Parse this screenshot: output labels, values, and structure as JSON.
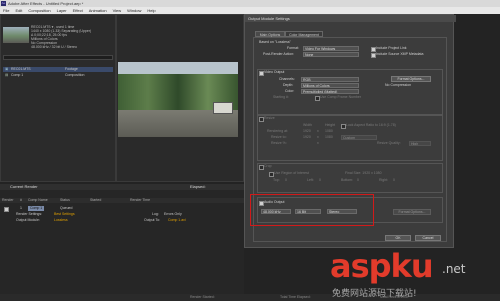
{
  "window": {
    "title": "Adobe After Effects - Untitled Project.aep *",
    "menu": [
      "File",
      "Edit",
      "Composition",
      "Layer",
      "Effect",
      "Animation",
      "View",
      "Window",
      "Help"
    ]
  },
  "project": {
    "info": [
      "REC01.MTS ▾ , used 1 time",
      "1440 x 1080 (1.33) Separating (Upper)",
      "Δ 0;00;22;18, 25.00 fps",
      "Millions of Colors",
      "No Compression",
      "48.000 kHz / 32 bit U / Stereo"
    ],
    "items": [
      {
        "name": "REC01.MTS",
        "type": "Footage"
      },
      {
        "name": "Comp 1",
        "type": "Composition"
      }
    ]
  },
  "timeline": {
    "header": "Current Render",
    "elapsed_label": "Elapsed:",
    "columns": [
      "Render",
      "#",
      "Comp Name",
      "Status",
      "Started",
      "Render Time"
    ],
    "row": {
      "num": "1",
      "comp": "Comp 1",
      "status": "Queued"
    },
    "render_settings_label": "Render Settings:",
    "render_settings_value": "Best Settings",
    "log_label": "Log:",
    "log_value": "Errors Only",
    "output_module_label": "Output Module:",
    "output_module_value": "Lossless",
    "output_to_label": "Output To:",
    "output_to_value": "Comp 1.avi"
  },
  "dialog": {
    "title": "Output Module Settings",
    "tabs": [
      "Main Options",
      "Color Management"
    ],
    "based_on_label": "Based on \"Lossless\"",
    "format_label": "Format:",
    "format_value": "Video For Windows",
    "post_render_label": "Post-Render Action:",
    "post_render_value": "None",
    "include_project_link": "Include Project Link",
    "include_xmp": "Include Source XMP Metadata",
    "video_output": "Video Output",
    "channels_label": "Channels:",
    "channels_value": "RGB",
    "format_options": "Format Options...",
    "depth_label": "Depth:",
    "depth_value": "Millions of Colors",
    "no_compression": "No Compression",
    "color_label": "Color:",
    "color_value": "Premultiplied (Matted)",
    "starting_label": "Starting #:",
    "use_comp_frame": "Use Comp Frame Number",
    "resize": "Resize",
    "width_label": "Width",
    "height_label": "Height",
    "lock_aspect": "Lock Aspect Ratio to 16:9 (1.78)",
    "rendering_at": "Rendering at:",
    "render_w": "1920",
    "render_h": "1080",
    "resize_to": "Resize to:",
    "resize_w": "1920",
    "resize_h": "1080",
    "custom": "Custom",
    "resize_pct": "Resize %:",
    "x_label": "x",
    "resize_quality": "Resize Quality:",
    "quality_value": "High",
    "crop": "Crop",
    "use_roi": "Use Region of Interest",
    "final_size": "Final Size: 1920 x 1080",
    "top": "Top:",
    "left": "Left:",
    "bottom": "Bottom:",
    "right": "Right:",
    "crop_val": "0",
    "audio_output": "Audio Output",
    "audio_rate": "48.000 kHz",
    "audio_bits": "16 Bit",
    "audio_channels": "Stereo",
    "format_options_audio": "Format Options...",
    "ok": "OK",
    "cancel": "Cancel"
  },
  "status": {
    "render_started": "Render Started:",
    "total_time": "Total Time Elapsed:",
    "recent_error": "Most Recent Error:"
  },
  "watermark": {
    "brand": "aspku",
    "tld": ".net",
    "sub": "免费网站源码下载站!"
  },
  "colors": {
    "highlight": "#d11a1a",
    "link": "#e0a000"
  }
}
